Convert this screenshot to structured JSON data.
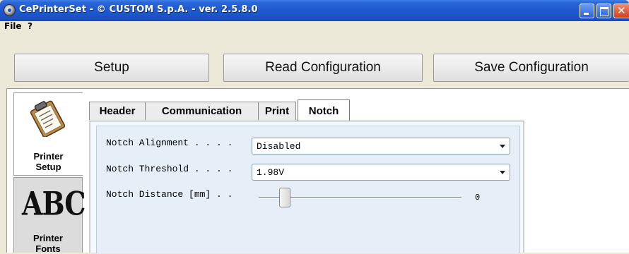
{
  "window": {
    "title": "CePrinterSet - © CUSTOM S.p.A. - ver. 2.5.8.0",
    "controls": [
      "minimize-icon",
      "maximize-icon",
      "close-icon"
    ]
  },
  "menu": {
    "items": [
      {
        "label": "File"
      },
      {
        "label": "?"
      }
    ]
  },
  "toolbar": {
    "setup_label": "Setup",
    "read_label": "Read Configuration",
    "save_label": "Save Configuration"
  },
  "sidebar": {
    "items": [
      {
        "label_line1": "Printer",
        "label_line2": "Setup",
        "icon": "clipboard-icon",
        "selected": true
      },
      {
        "label_line1": "Printer",
        "label_line2": "Fonts",
        "icon": "abc-icon",
        "icon_text": "ABC",
        "selected": false
      }
    ]
  },
  "tabs": [
    {
      "label": "Header"
    },
    {
      "label": "Communication"
    },
    {
      "label": "Print"
    },
    {
      "label": "Notch",
      "active": true
    }
  ],
  "notch": {
    "alignment_label": "Notch Alignment . . . . ",
    "alignment_value": "Disabled",
    "threshold_label": "Notch Threshold . . . . ",
    "threshold_value": "1.98V",
    "distance_label": "Notch Distance [mm] . . ",
    "distance_value": "0"
  }
}
